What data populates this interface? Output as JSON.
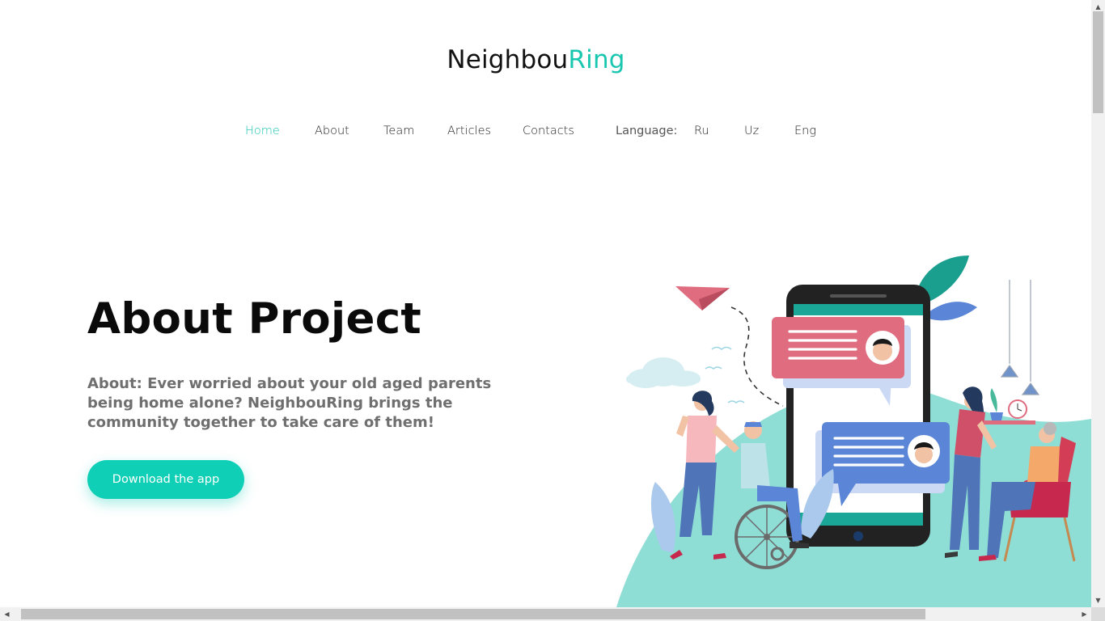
{
  "brand": {
    "part1": "Neighbou",
    "part2": "Ring"
  },
  "nav": {
    "items": [
      "Home",
      "About",
      "Team",
      "Articles",
      "Contacts"
    ],
    "active": "Home",
    "language_label": "Language:",
    "languages": [
      "Ru",
      "Uz",
      "Eng"
    ]
  },
  "hero": {
    "title": "About Project",
    "text": "About: Ever worried about your old aged parents being home alone? NeighbouRing brings the community together to take care of them!",
    "cta_label": "Download the app"
  },
  "colors": {
    "accent": "#19c6b0",
    "button": "#0fcfb6",
    "hill": "#8fded6",
    "bubble_pink": "#e06c7f",
    "bubble_blue": "#5b85d6"
  },
  "icons": {
    "scroll_up": "scroll-up-arrow-icon",
    "scroll_down": "scroll-down-arrow-icon",
    "scroll_left": "scroll-left-arrow-icon",
    "scroll_right": "scroll-right-arrow-icon"
  }
}
